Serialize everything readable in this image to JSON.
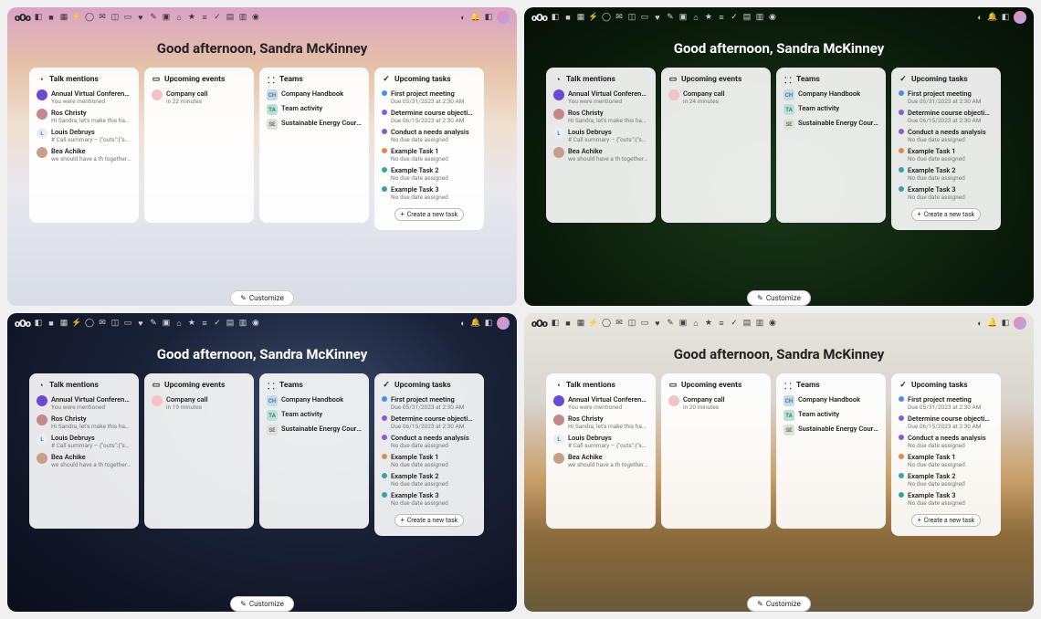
{
  "greeting": "Good afternoon, Sandra McKinney",
  "customize": "Customize",
  "create_task": "Create a new task",
  "widgets": {
    "talk": "Talk mentions",
    "events": "Upcoming events",
    "teams": "Teams",
    "tasks": "Upcoming tasks"
  },
  "mentions": [
    {
      "who": "Annual Virtual Conference",
      "sub": "You were mentioned",
      "color": "#6a4ad2"
    },
    {
      "who": "Ros Christy",
      "sub": "Hi Sandra, let's make this hap…",
      "color": "#c28a8a"
    },
    {
      "who": "Louis Debruys",
      "sub": "# Call summary – {\"outs\":{\"sam…",
      "color": "#e8eef6",
      "text": "L"
    },
    {
      "who": "Bea Achike",
      "sub": "we should have a th together …",
      "color": "#c2a08a"
    }
  ],
  "events": [
    {
      "title": "Company call",
      "sub": "in 22 minutes",
      "color": "#f4c2c2"
    }
  ],
  "events_variants": {
    "pane1": "in 22 minutes",
    "pane2": "in 24 minutes",
    "pane3": "in 19 minutes",
    "pane4": "in 20 minutes"
  },
  "teams": [
    {
      "code": "CH",
      "name": "Company Handbook",
      "color": "#c2dce8"
    },
    {
      "code": "TA",
      "name": "Team activity",
      "color": "#b8e2d2"
    },
    {
      "code": "SE",
      "name": "Sustainable Energy Course",
      "color": "#e0e0d0"
    }
  ],
  "tasks": [
    {
      "title": "First project meeting",
      "sub": "Due 05/31/2023 at 2:30 AM",
      "color": "blue"
    },
    {
      "title": "Determine course objectives",
      "sub": "Due 06/15/2023 at 2:30 AM",
      "color": "purple"
    },
    {
      "title": "Conduct a needs analysis",
      "sub": "No due date assigned",
      "color": "purple"
    },
    {
      "title": "Example Task 1",
      "sub": "No due date assigned",
      "color": "orange"
    },
    {
      "title": "Example Task 2",
      "sub": "No due date assigned",
      "color": "teal"
    },
    {
      "title": "Example Task 3",
      "sub": "No due date assigned",
      "color": "teal"
    }
  ]
}
